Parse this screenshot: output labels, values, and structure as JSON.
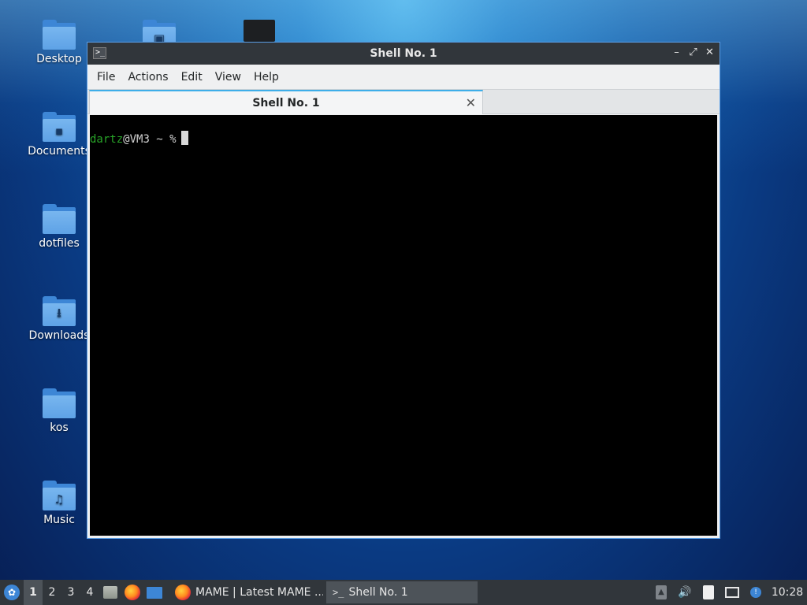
{
  "desktop": {
    "icons": [
      {
        "label": "Desktop",
        "glyph": ""
      },
      {
        "label": "Documents",
        "glyph": "▪"
      },
      {
        "label": "dotfiles",
        "glyph": ""
      },
      {
        "label": "Downloads",
        "glyph": "⭳"
      },
      {
        "label": "kos",
        "glyph": ""
      },
      {
        "label": "Music",
        "glyph": "♫"
      }
    ],
    "pictures_glyph": "▣"
  },
  "window": {
    "title": "Shell No. 1",
    "app_icon": ">_",
    "controls": {
      "minimize": "–",
      "maximize": "⤢",
      "close": "✕"
    },
    "menu": [
      "File",
      "Actions",
      "Edit",
      "View",
      "Help"
    ],
    "tab": {
      "title": "Shell No. 1",
      "close": "✕"
    },
    "terminal": {
      "user": "dartz",
      "host_rest": "@VM3 ~ %"
    }
  },
  "taskbar": {
    "start_glyph": "✿",
    "workspaces": [
      "1",
      "2",
      "3",
      "4"
    ],
    "active_workspace": "1",
    "tasks": [
      {
        "label": "MAME | Latest MAME ...",
        "icon": "firefox-icon"
      },
      {
        "label": "Shell No. 1",
        "icon": "terminal-icon"
      }
    ],
    "task_terminal_glyph": ">_",
    "tray": {
      "volume_glyph": "🔊",
      "update_glyph": "!",
      "arrow_glyph": "▲"
    },
    "clock": "10:28"
  },
  "colors": {
    "accent": "#3daee9",
    "prompt_user": "#28a428",
    "titlebar": "#31363b"
  }
}
